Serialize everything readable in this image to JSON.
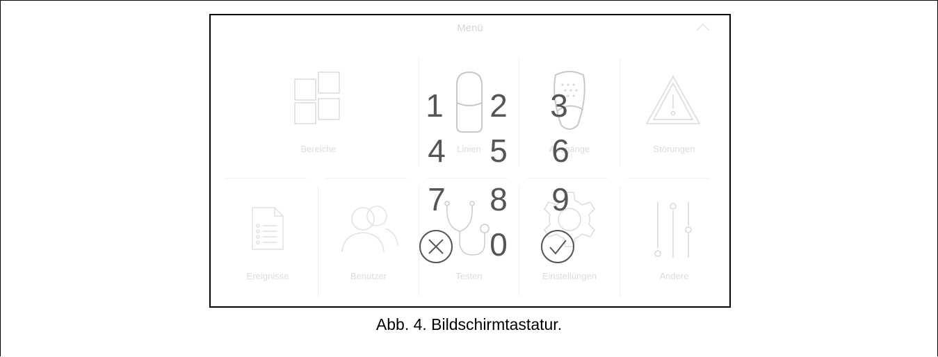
{
  "screen": {
    "title": "Menü",
    "tiles": {
      "bereiche": "Bereiche",
      "linien": "Linien",
      "ausgaenge": "Ausgänge",
      "stoerungen": "Störungen",
      "ereignisse": "Ereignisse",
      "benutzer": "Benutzer",
      "testen": "Testen",
      "einstellungen": "Einstellungen",
      "andere": "Andere"
    },
    "keypad": {
      "k1": "1",
      "k2": "2",
      "k3": "3",
      "k4": "4",
      "k5": "5",
      "k6": "6",
      "k7": "7",
      "k8": "8",
      "k9": "9",
      "k0": "0",
      "cancel_icon": "cancel-circle-icon",
      "confirm_icon": "check-circle-icon"
    }
  },
  "caption": "Abb. 4. Bildschirmtastatur.",
  "colors": {
    "keypad_text": "#555555",
    "faded_text": "#dcdcdc",
    "border": "#000000"
  }
}
